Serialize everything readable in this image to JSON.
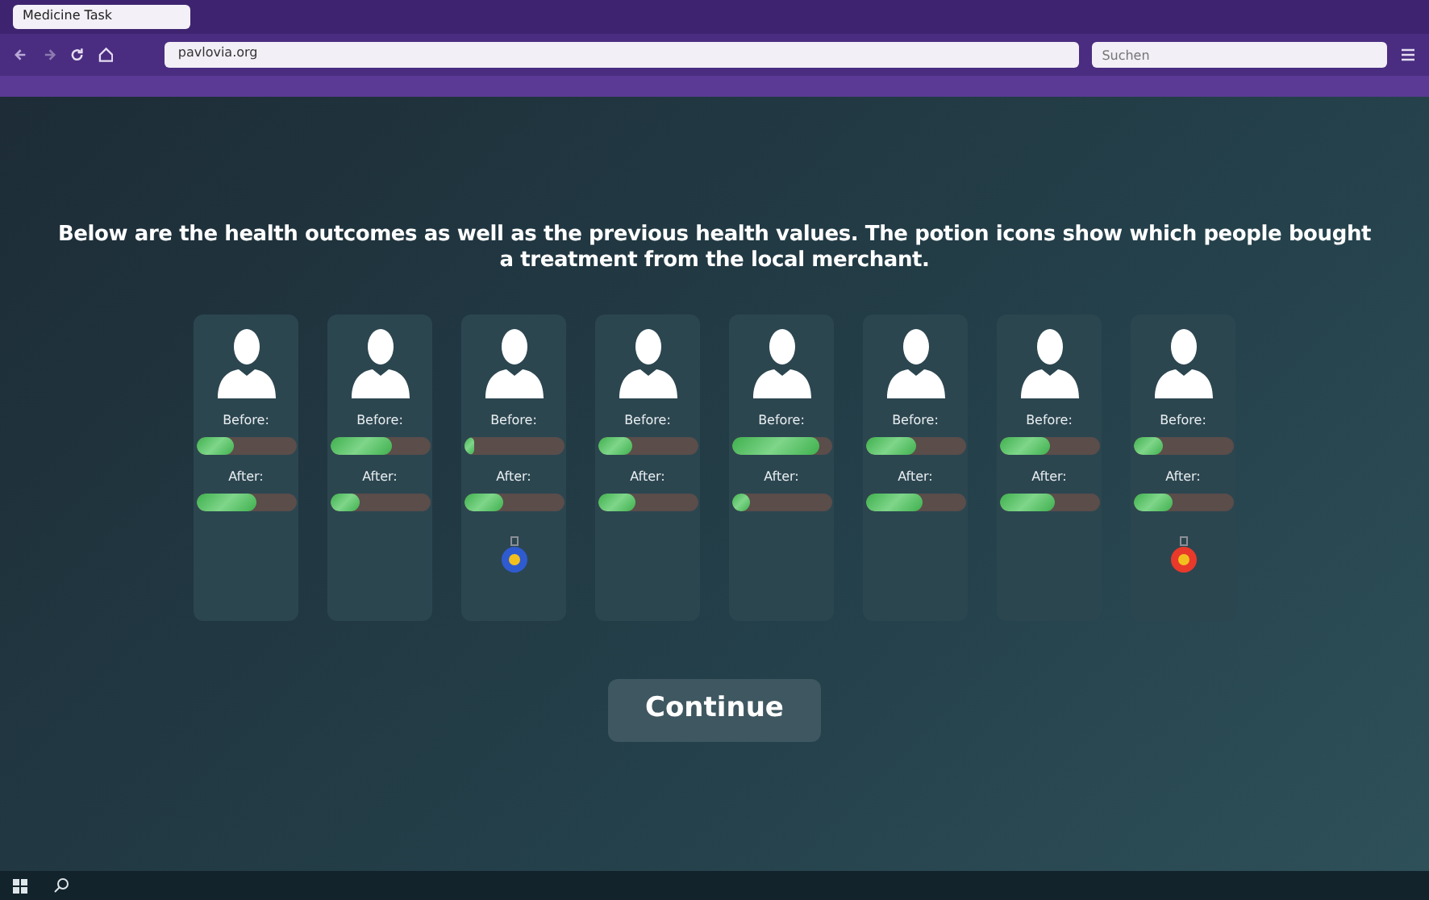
{
  "browser": {
    "tabs": [
      {
        "label": "Medicine Task",
        "selected": true
      }
    ],
    "address": "pavlovia.org",
    "search": {
      "placeholder": "Suchen"
    }
  },
  "heading": "Below are the health outcomes as well as the previous health values. The potion icons show which people bought a treatment from the local merchant.",
  "people": [
    {
      "before_label": "Before:",
      "before": {
        "level": 0.38
      },
      "after_label": "After:",
      "after": {
        "level": 0.6
      }
    },
    {
      "before_label": "Before:",
      "before": {
        "level": 0.62
      },
      "after_label": "After:",
      "after": {
        "level": 0.3
      }
    },
    {
      "before_label": "Before:",
      "before": {
        "level": 0.1
      },
      "after_label": "After:",
      "after": {
        "level": 0.4
      },
      "potion": {
        "color": "#2f5bd0"
      }
    },
    {
      "before_label": "Before:",
      "before": {
        "level": 0.35
      },
      "after_label": "After:",
      "after": {
        "level": 0.38
      }
    },
    {
      "before_label": "Before:",
      "before": {
        "level": 0.88
      },
      "after_label": "After:",
      "after": {
        "level": 0.18
      }
    },
    {
      "before_label": "Before:",
      "before": {
        "level": 0.5
      },
      "after_label": "After:",
      "after": {
        "level": 0.58
      }
    },
    {
      "before_label": "Before:",
      "before": {
        "level": 0.5
      },
      "after_label": "After:",
      "after": {
        "level": 0.56
      }
    },
    {
      "before_label": "Before:",
      "before": {
        "level": 0.3
      },
      "after_label": "After:",
      "after": {
        "level": 0.4
      },
      "potion": {
        "color": "#e8392b"
      }
    }
  ],
  "continue_button": "Continue"
}
